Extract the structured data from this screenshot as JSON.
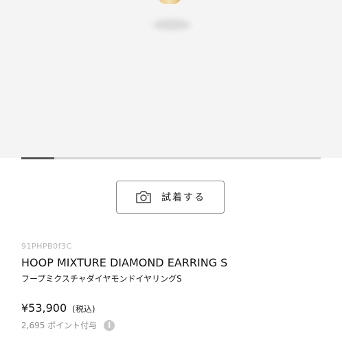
{
  "gallery": {
    "progress_fraction": 0.11
  },
  "try_on": {
    "label": "試着する",
    "icon": "camera-icon"
  },
  "product": {
    "sku": "91PHPB0f3C",
    "name_en": "HOOP MIXTURE DIAMOND EARRING S",
    "name_ja": "フープミクスチャダイヤモンドイヤリングS",
    "price": "¥53,900",
    "tax_note": "(税込)",
    "points": "2,695 ポイント付与",
    "info_icon": "info-icon"
  },
  "colors": {
    "image_bg": "#f4f4f4",
    "progress_fill": "#555555",
    "progress_track": "#d6d6d6",
    "muted_text": "#8c8c8c"
  }
}
